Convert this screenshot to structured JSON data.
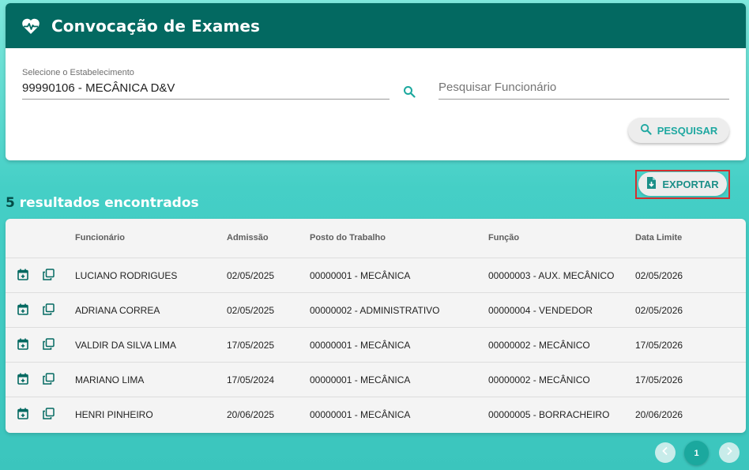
{
  "header": {
    "title": "Convocação de Exames",
    "icon": "heart-pulse-icon"
  },
  "filters": {
    "estab_label": "Selecione o Estabelecimento",
    "estab_value": "99990106 - MECÂNICA D&V",
    "func_placeholder": "Pesquisar Funcionário",
    "search_button": "PESQUISAR"
  },
  "results": {
    "count": "5",
    "text": "resultados encontrados"
  },
  "export_button": "EXPORTAR",
  "table": {
    "headers": [
      "Funcionário",
      "Admissão",
      "Posto do Trabalho",
      "Função",
      "Data Limite"
    ],
    "rows": [
      {
        "funcionario": "LUCIANO RODRIGUES",
        "admissao": "02/05/2025",
        "posto": "00000001 - MECÂNICA",
        "funcao": "00000003 - AUX. MECÂNICO",
        "data_limite": "02/05/2026"
      },
      {
        "funcionario": "ADRIANA CORREA",
        "admissao": "02/05/2025",
        "posto": "00000002 - ADMINISTRATIVO",
        "funcao": "00000004 - VENDEDOR",
        "data_limite": "02/05/2026"
      },
      {
        "funcionario": "VALDIR DA SILVA LIMA",
        "admissao": "17/05/2025",
        "posto": "00000001 - MECÂNICA",
        "funcao": "00000002 - MECÂNICO",
        "data_limite": "17/05/2026"
      },
      {
        "funcionario": "MARIANO LIMA",
        "admissao": "17/05/2024",
        "posto": "00000001 - MECÂNICA",
        "funcao": "00000002 - MECÂNICO",
        "data_limite": "17/05/2026"
      },
      {
        "funcionario": "HENRI PINHEIRO",
        "admissao": "20/06/2025",
        "posto": "00000001 - MECÂNICA",
        "funcao": "00000005 - BORRACHEIRO",
        "data_limite": "20/06/2026"
      }
    ]
  },
  "pagination": {
    "current": "1"
  },
  "colors": {
    "header": "#036961",
    "accent": "#1ba89e",
    "export_highlight": "#d32f2f"
  }
}
